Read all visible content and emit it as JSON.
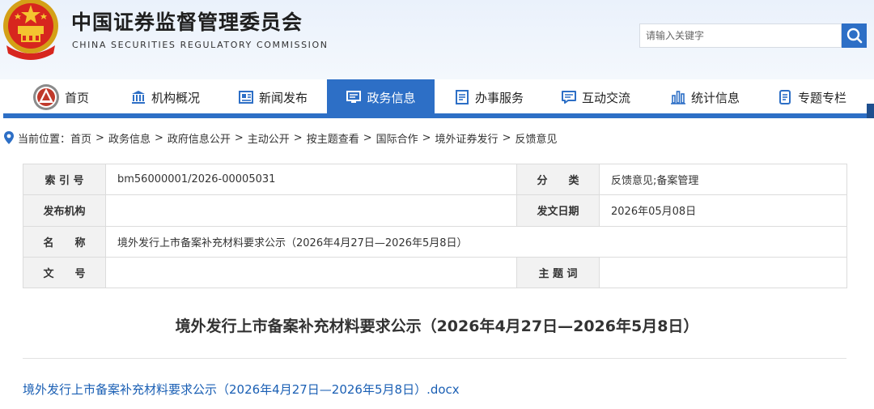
{
  "site": {
    "title": "中国证券监督管理委员会",
    "subtitle": "CHINA SECURITIES REGULATORY COMMISSION"
  },
  "search": {
    "placeholder": "请输入关键字",
    "value": "",
    "button_icon": "search-icon"
  },
  "nav": {
    "items": [
      {
        "label": "首页",
        "icon": "emblem-icon"
      },
      {
        "label": "机构概况",
        "icon": "institution-icon"
      },
      {
        "label": "新闻发布",
        "icon": "news-icon"
      },
      {
        "label": "政务信息",
        "icon": "monitor-icon",
        "active": true
      },
      {
        "label": "办事服务",
        "icon": "service-list-icon"
      },
      {
        "label": "互动交流",
        "icon": "chat-icon"
      },
      {
        "label": "统计信息",
        "icon": "bar-chart-icon"
      },
      {
        "label": "专题专栏",
        "icon": "document-icon"
      }
    ],
    "accent_color": "#2d6fc6"
  },
  "breadcrumb": {
    "prefix": "当前位置：",
    "items": [
      "首页",
      "政务信息",
      "政府信息公开",
      "主动公开",
      "按主题查看",
      "国际合作",
      "境外证券发行",
      "反馈意见"
    ],
    "separator": ">"
  },
  "info": {
    "index_label": "索 引 号",
    "index_value": "bm56000001/2026-00005031",
    "category_label": "分　　类",
    "category_value": "反馈意见;备案管理",
    "publisher_label": "发布机构",
    "publisher_value": "",
    "date_label": "发文日期",
    "date_value": "2026年05月08日",
    "name_label": "名　　称",
    "name_value": "境外发行上市备案补充材料要求公示（2026年4月27日—2026年5月8日）",
    "docno_label": "文　　号",
    "docno_value": "",
    "subject_label": "主 题 词",
    "subject_value": ""
  },
  "document": {
    "title": "境外发行上市备案补充材料要求公示（2026年4月27日—2026年5月8日）",
    "attachment": "境外发行上市备案补充材料要求公示（2026年4月27日—2026年5月8日）.docx"
  }
}
